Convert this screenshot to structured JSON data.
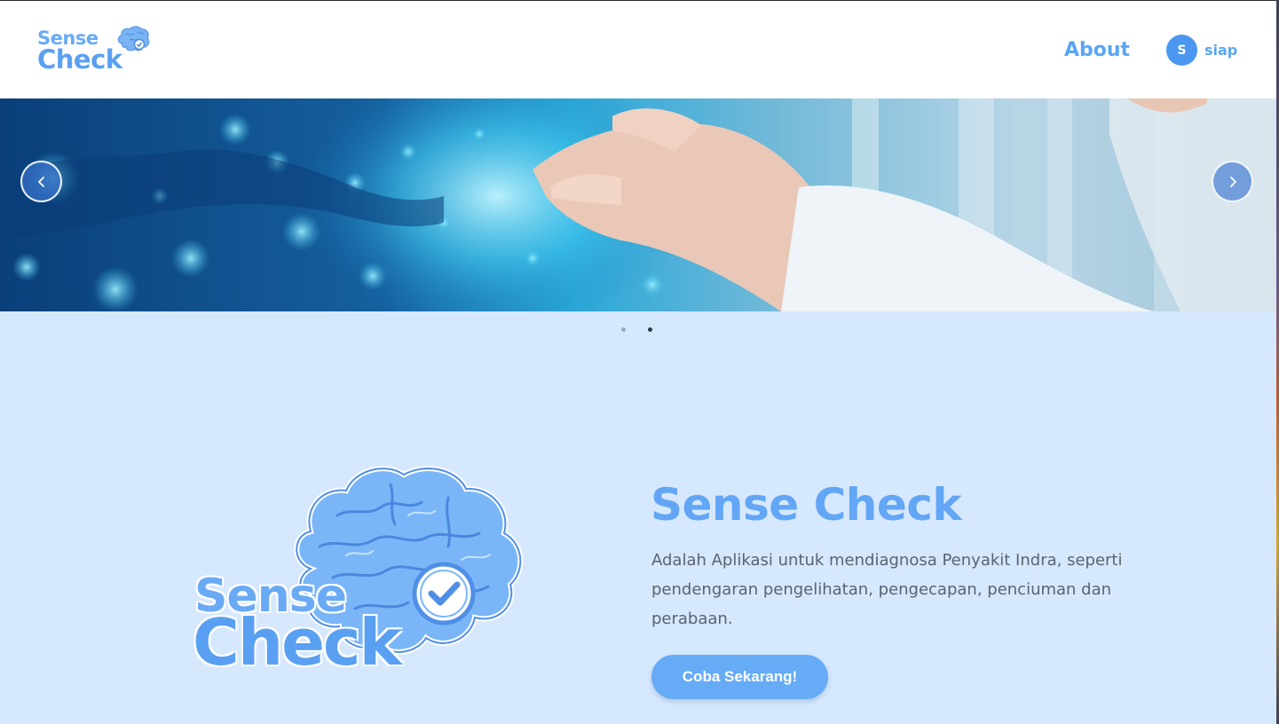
{
  "header": {
    "logo_line1": "Sense",
    "logo_line2": "Check",
    "nav_about": "About",
    "user_initial": "S",
    "user_name": "siap"
  },
  "carousel": {
    "prev_icon": "chevron-left-icon",
    "next_icon": "chevron-right-icon",
    "slide_count": 2,
    "active_slide": 2
  },
  "hero": {
    "logo_line1": "Sense",
    "logo_line2": "Check",
    "title": "Sense Check",
    "description": "Adalah Aplikasi untuk mendiagnosa Penyakit Indra, seperti pendengaran pengelihatan, pengecapan, penciuman dan perabaan.",
    "cta_label": "Coba Sekarang!"
  },
  "colors": {
    "accent": "#5aa6f5",
    "hero_bg": "#d6e8fd",
    "button": "#66abf5"
  }
}
